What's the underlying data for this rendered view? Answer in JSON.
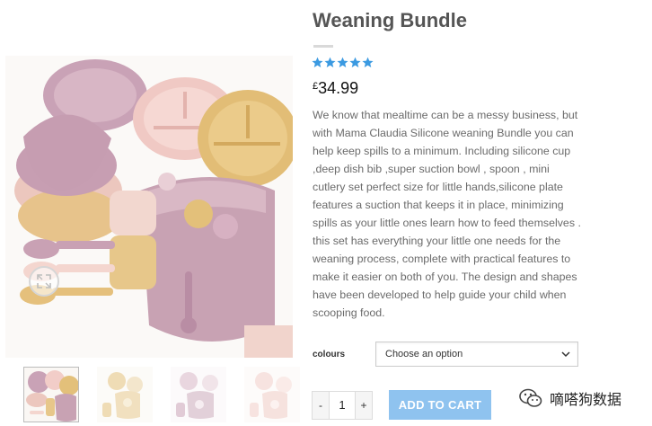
{
  "product": {
    "title": "Weaning Bundle",
    "rating_stars": 5,
    "price_currency": "£",
    "price_amount": "34.99",
    "description": "We know that mealtime can be a  messy business, but with Mama Claudia  Silicone weaning Bundle  you can help keep spills to a minimum. Including silicone cup ,deep dish bib ,super suction bowl  , spoon , mini cutlery set perfect size for little hands,silicone  plate features a suction that keeps it in place, minimizing spills as your little ones learn how to feed themselves . this set has everything your little one needs for the weaning process, complete with practical features to make it easier on both of you. The design and shapes have been developed to help guide your child when scooping food."
  },
  "variation": {
    "label": "colours",
    "select_value": "Choose an option"
  },
  "cart": {
    "minus_label": "-",
    "quantity": "1",
    "plus_label": "+",
    "add_button_label": "ADD TO CART"
  },
  "watermark": {
    "text": "嘀嗒狗数据",
    "icon": "wechat-icon"
  },
  "colors": {
    "accent_star": "#3b9ae1",
    "cart_button": "#8fc3ef",
    "mauve": "#c9a5b7",
    "pink": "#f2cdc8",
    "mustard": "#e3c07a"
  },
  "icons": [
    "zoom-expand-icon",
    "star-icon",
    "chevron-down-icon",
    "wechat-icon"
  ]
}
